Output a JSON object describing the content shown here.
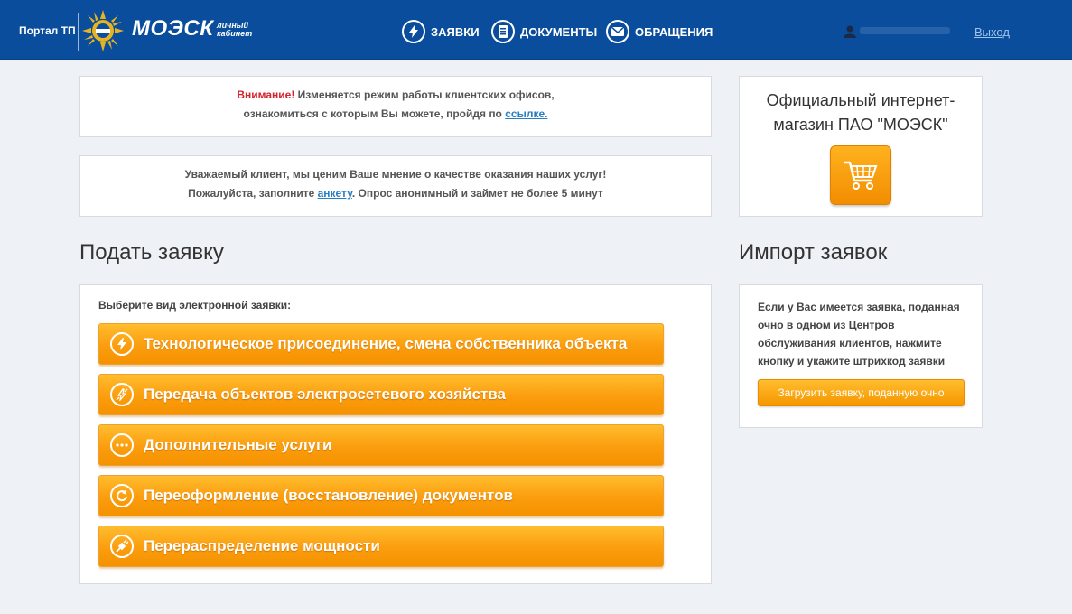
{
  "header": {
    "portal_label": "Портал ТП",
    "logo_text": "МОЭСК",
    "logo_sub_1": "личный",
    "logo_sub_2": "кабинет",
    "nav": [
      {
        "label": "ЗАЯВКИ",
        "icon": "lightning-icon"
      },
      {
        "label": "ДОКУМЕНТЫ",
        "icon": "document-icon"
      },
      {
        "label": "ОБРАЩЕНИЯ",
        "icon": "envelope-icon"
      }
    ],
    "logout_label": "Выход"
  },
  "notice1": {
    "attention": "Внимание!",
    "line1": " Изменяется режим работы клиентских офисов,",
    "line2": "ознакомиться с которым Вы можете, пройдя по ",
    "link": "ссылке."
  },
  "notice2": {
    "line1": "Уважаемый клиент, мы ценим Ваше мнение о качестве оказания наших услуг!",
    "line2_pre": "Пожалуйста, заполните ",
    "link": "анкету",
    "line2_post": ". Опрос анонимный и займет не более 5 минут"
  },
  "shop": {
    "title": "Официальный интернет-магазин ПАО \"МОЭСК\""
  },
  "request": {
    "heading": "Подать заявку",
    "caption": "Выберите вид электронной заявки:",
    "buttons": [
      {
        "label": "Технологическое присоединение, смена собственника объекта",
        "icon": "lightning-icon"
      },
      {
        "label": "Передача объектов электросетевого хозяйства",
        "icon": "transfer-icon"
      },
      {
        "label": "Дополнительные услуги",
        "icon": "dots-icon"
      },
      {
        "label": "Переоформление (восстановление) документов",
        "icon": "refresh-icon"
      },
      {
        "label": "Перераспределение мощности",
        "icon": "plug-icon"
      }
    ]
  },
  "import": {
    "heading": "Импорт заявок",
    "text": "Если у Вас имеется заявка, поданная очно в одном из Центров обслуживания клиентов, нажмите кнопку и укажите штрихкод заявки",
    "button": "Загрузить заявку, поданную очно"
  },
  "colors": {
    "header_bg": "#0a4d9c",
    "accent_orange": "#fb9d0e",
    "attention_red": "#d2232a",
    "link_blue": "#2a7fc1"
  }
}
